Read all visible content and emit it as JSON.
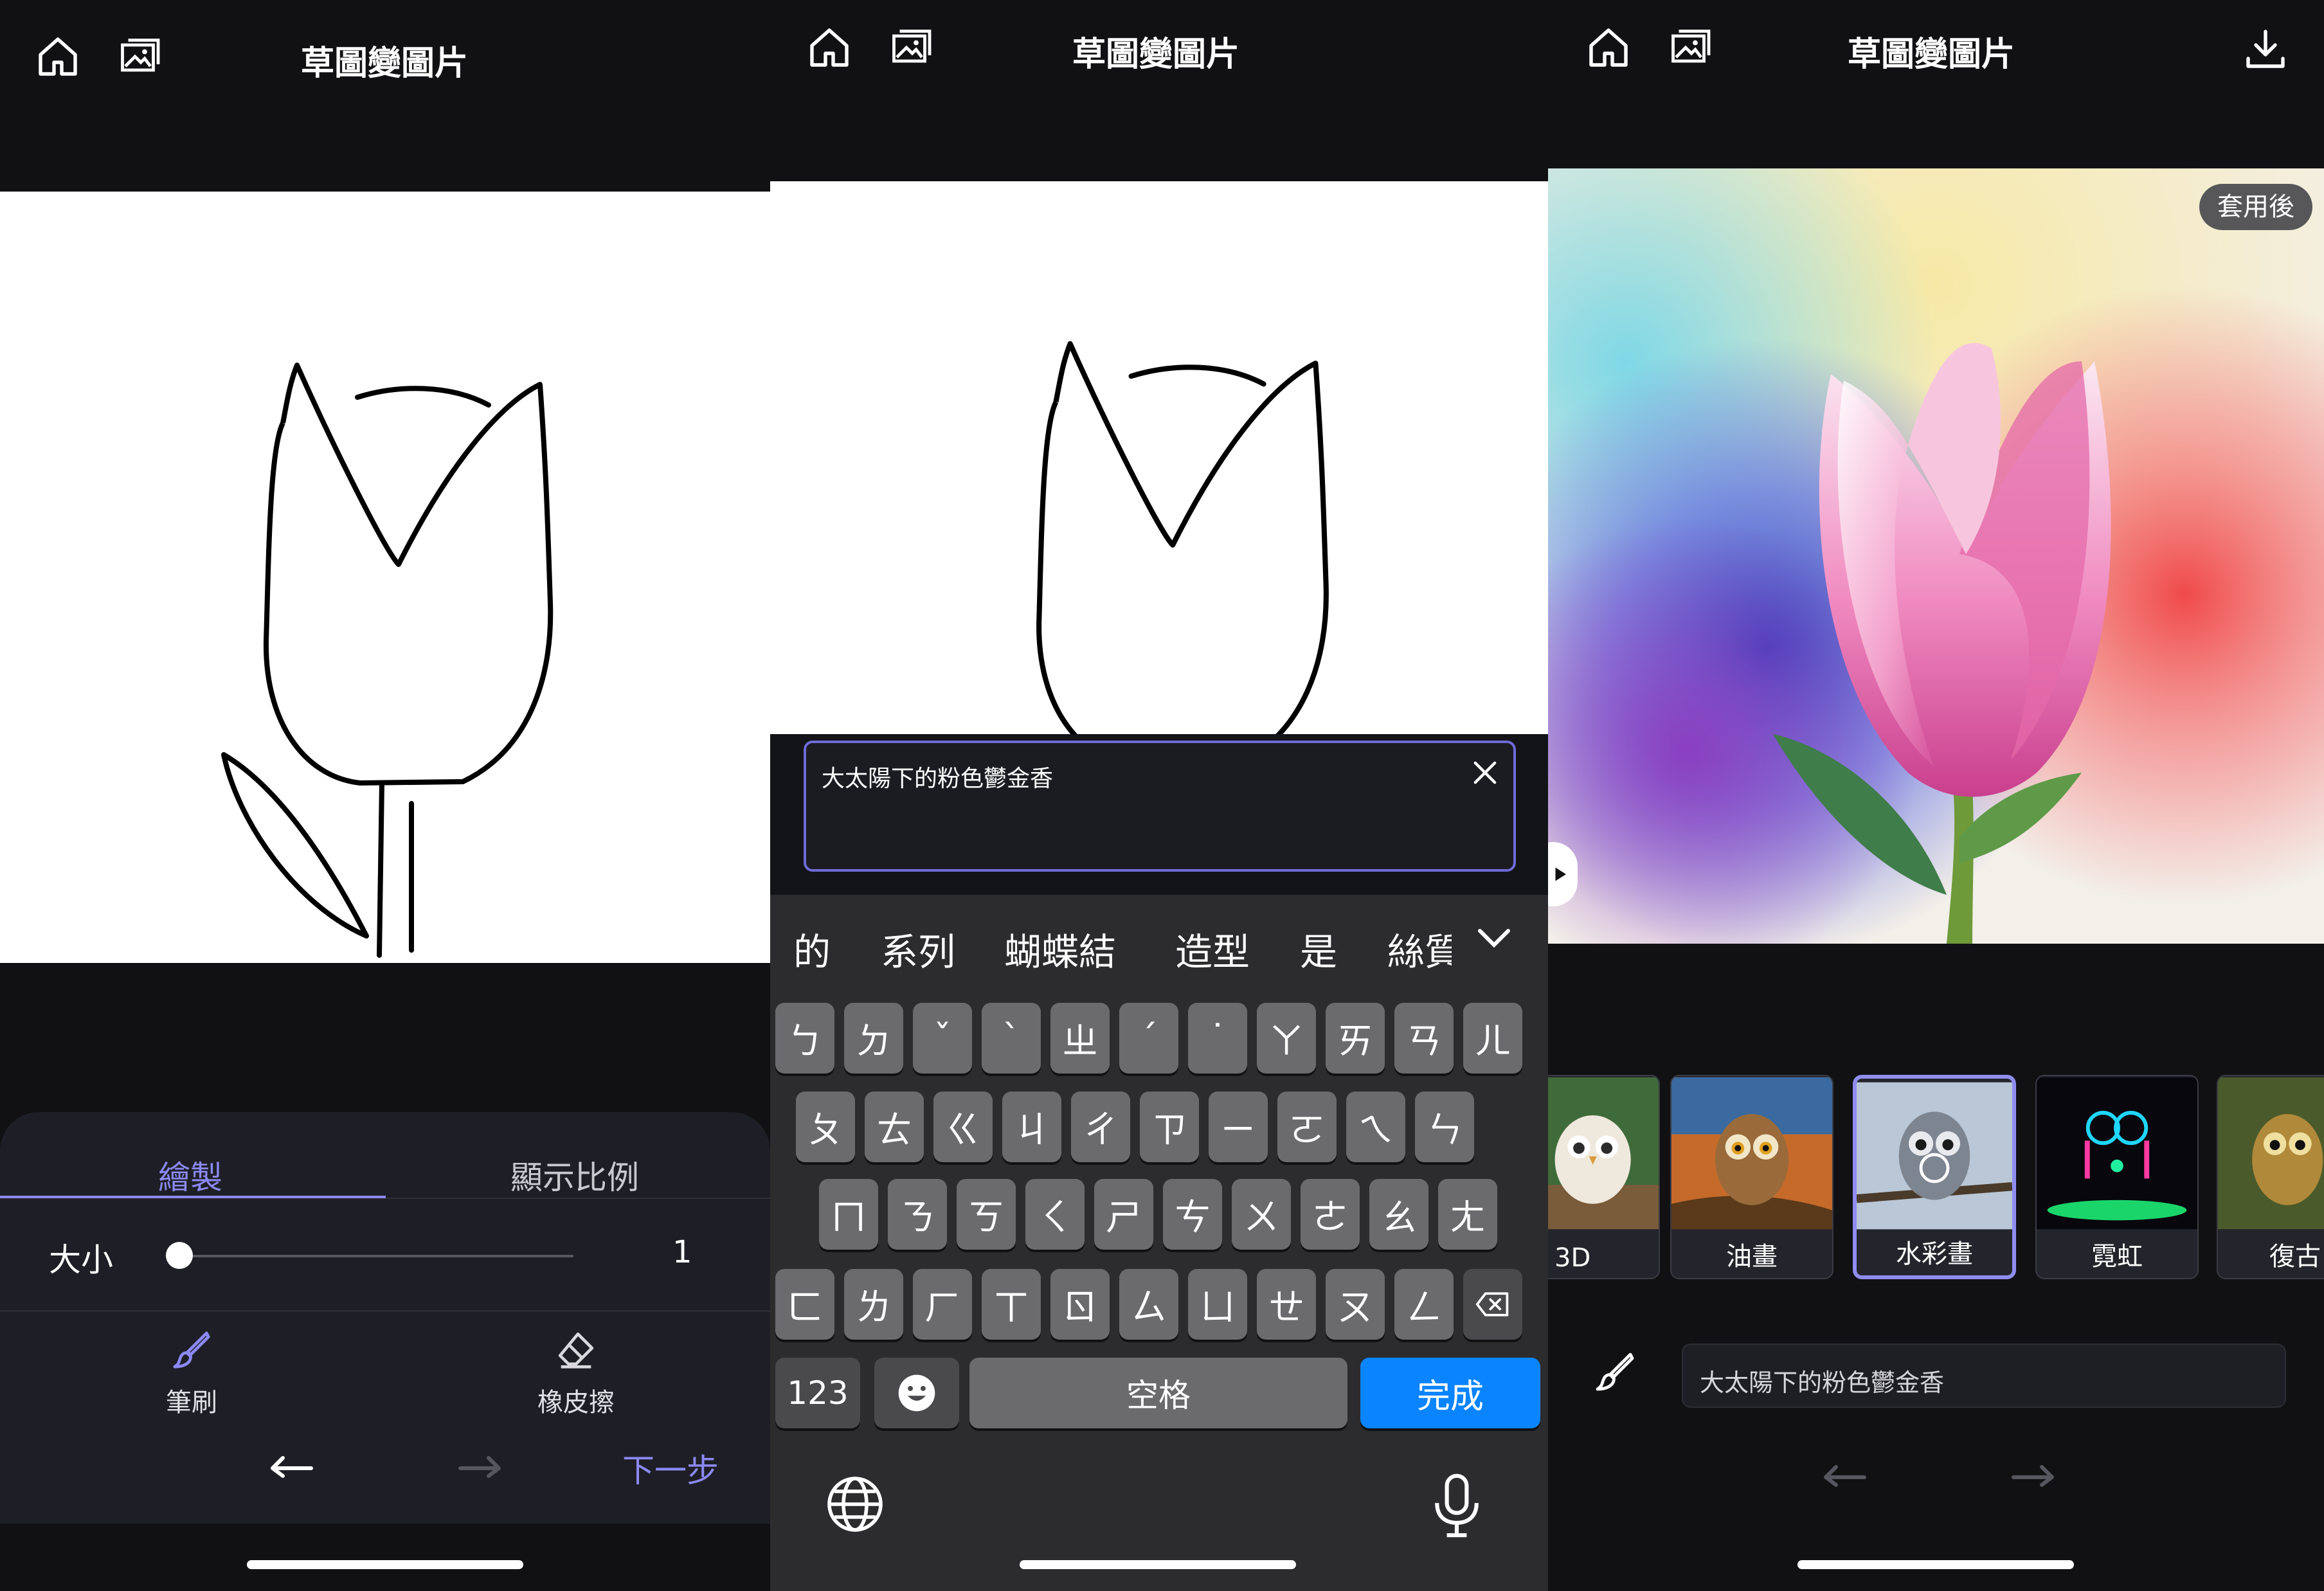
{
  "app": {
    "title": "草圖變圖片"
  },
  "colors": {
    "accent": "#8c89f5",
    "keyboard_done": "#0a84ff",
    "background": "#111113"
  },
  "panel1": {
    "tabs": [
      {
        "label": "繪製",
        "active": true
      },
      {
        "label": "顯示比例",
        "active": false
      }
    ],
    "size": {
      "label": "大小",
      "value": "1",
      "fraction": 0.0
    },
    "tools": [
      {
        "label": "筆刷",
        "icon": "brush-icon"
      },
      {
        "label": "橡皮擦",
        "icon": "eraser-icon"
      }
    ],
    "next_label": "下一步"
  },
  "panel2": {
    "input_text": "大太陽下的粉色鬱金香",
    "candidates": [
      "的",
      "系列",
      "蝴蝶結",
      "造型",
      "是",
      "絲質"
    ],
    "keys": {
      "row1": [
        "ㄅ",
        "ㄉ",
        "ˇ",
        "ˋ",
        "ㄓ",
        "ˊ",
        "˙",
        "ㄚ",
        "ㄞ",
        "ㄢ",
        "ㄦ"
      ],
      "row2": [
        "ㄆ",
        "ㄊ",
        "ㄍ",
        "ㄐ",
        "ㄔ",
        "ㄗ",
        "ㄧ",
        "ㄛ",
        "ㄟ",
        "ㄣ"
      ],
      "row3": [
        "ㄇ",
        "ㄋ",
        "ㄎ",
        "ㄑ",
        "ㄕ",
        "ㄘ",
        "ㄨ",
        "ㄜ",
        "ㄠ",
        "ㄤ"
      ],
      "row4": [
        "ㄈ",
        "ㄌ",
        "ㄏ",
        "ㄒ",
        "ㄖ",
        "ㄙ",
        "ㄩ",
        "ㄝ",
        "ㄡ",
        "ㄥ"
      ]
    },
    "numbers_key": "123",
    "space_key": "空格",
    "done_key": "完成"
  },
  "panel3": {
    "apply_badge": "套用後",
    "styles": [
      {
        "label": "3D",
        "selected": false
      },
      {
        "label": "油畫",
        "selected": false
      },
      {
        "label": "水彩畫",
        "selected": true
      },
      {
        "label": "霓虹",
        "selected": false
      },
      {
        "label": "復古",
        "selected": false
      }
    ],
    "prompt_text": "大太陽下的粉色鬱金香"
  }
}
